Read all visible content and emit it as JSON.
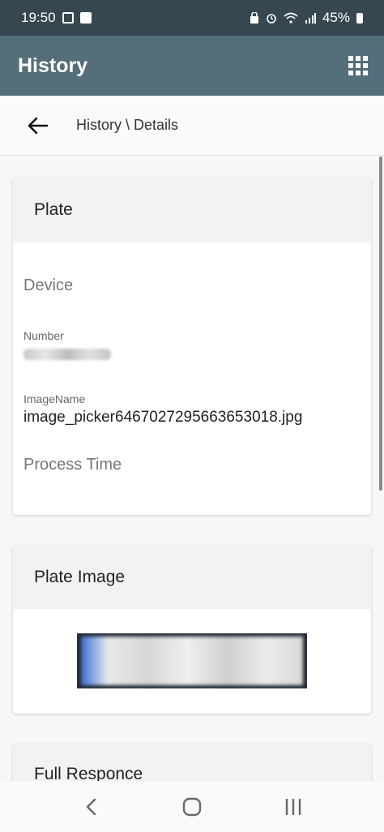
{
  "status_bar": {
    "time": "19:50",
    "battery": "45%",
    "icons": [
      "gallery-icon",
      "check-icon",
      "lock-icon",
      "alarm-icon",
      "wifi-icon",
      "signal-icon",
      "battery-icon"
    ]
  },
  "app_bar": {
    "title": "History",
    "menu_icon": "apps-grid-icon"
  },
  "breadcrumb": {
    "back_icon": "arrow-left-icon",
    "text": "History \\ Details"
  },
  "cards": {
    "plate": {
      "title": "Plate",
      "device_label": "Device",
      "number_label": "Number",
      "image_name_label": "ImageName",
      "image_name_value": "image_picker6467027295663653018.jpg",
      "process_time_label": "Process Time"
    },
    "plate_image": {
      "title": "Plate Image"
    },
    "full_response": {
      "title": "Full Responce"
    }
  },
  "nav_bar": {
    "icons": [
      "back-nav-icon",
      "home-nav-icon",
      "recents-nav-icon"
    ]
  },
  "colors": {
    "status_bar": "#37474f",
    "app_bar": "#546e7a",
    "background": "#f7f7f7",
    "card_header": "#f2f2f2"
  }
}
